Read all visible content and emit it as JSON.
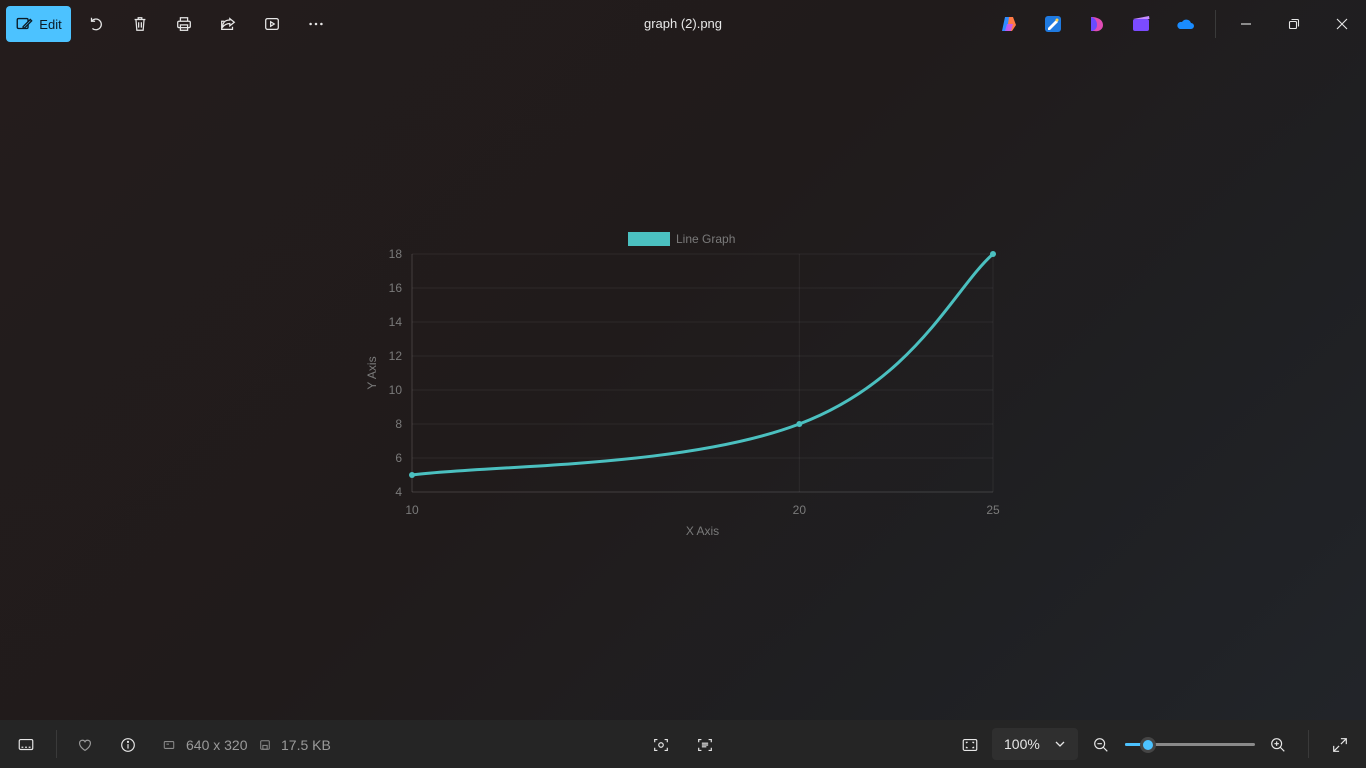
{
  "window": {
    "title": "graph (2).png"
  },
  "toolbar": {
    "edit_label": "Edit",
    "accent_color": "#4cc2ff"
  },
  "statusbar": {
    "dimensions": "640 x 320",
    "file_size": "17.5 KB",
    "zoom_value": "100%",
    "zoom_slider_fraction": 0.18
  },
  "chart_data": {
    "type": "line",
    "x": [
      10,
      20,
      25
    ],
    "series": [
      {
        "name": "Line Graph",
        "values": [
          5,
          8,
          18
        ],
        "color": "#4bc0c0"
      }
    ],
    "xlabel": "X Axis",
    "ylabel": "Y Axis",
    "xticks": [
      "10",
      "20",
      "25"
    ],
    "yticks": [
      "4",
      "6",
      "8",
      "10",
      "12",
      "14",
      "16",
      "18"
    ],
    "ylim": [
      4,
      18
    ],
    "grid": true,
    "legend": "top",
    "smooth": true
  }
}
